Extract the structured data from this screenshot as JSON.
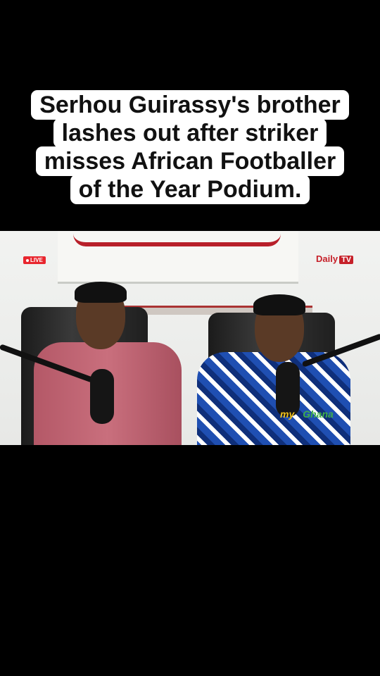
{
  "headline": {
    "lines": [
      "Serhou Guirassy's brother",
      "lashes out after striker",
      "misses African Footballer",
      "of the Year Podium."
    ]
  },
  "video": {
    "live_badge": "LIVE",
    "brand_name": "Daily",
    "brand_tv": "TV",
    "watermark_left": "my",
    "watermark_right": "Ghana"
  }
}
